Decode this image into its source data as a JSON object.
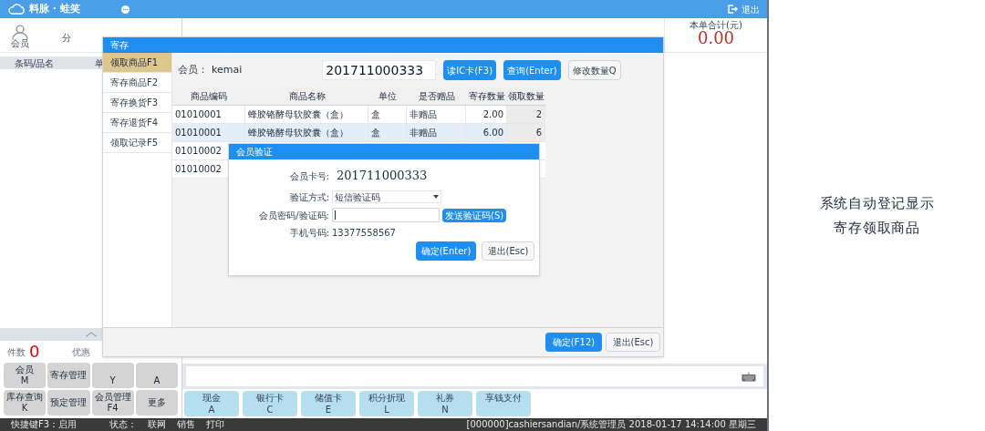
{
  "app": {
    "title": "料脉 · 蛙笑",
    "logout": "退出"
  },
  "header": {
    "member_label": "会员",
    "points_label": "分",
    "total_label": "本单合计(元)",
    "total": "0.00"
  },
  "left_panel": {
    "columns": [
      "条码/品名",
      "单"
    ],
    "count_label": "件数",
    "count": "0",
    "discount_label": "优惠"
  },
  "function_buttons": [
    {
      "label": "会员",
      "key": "M"
    },
    {
      "label": "寄存管理"
    },
    {
      "key": "Y"
    },
    {
      "key": "A"
    },
    {
      "label": "库存查询",
      "key": "K"
    },
    {
      "label": "预定管理"
    },
    {
      "label": "会员管理",
      "key": "F4"
    },
    {
      "label": "更多"
    }
  ],
  "payment_buttons": [
    {
      "label": "现金",
      "key": "A"
    },
    {
      "label": "银行卡",
      "key": "C"
    },
    {
      "label": "储值卡",
      "key": "E"
    },
    {
      "label": "积分折现",
      "key": "L"
    },
    {
      "label": "礼券",
      "key": "N"
    },
    {
      "label": "享钱支付"
    }
  ],
  "status_bar": {
    "items": [
      "快捷键F3：启用",
      "状态：",
      "联网",
      "销售",
      "打印"
    ],
    "right": "[000000]cashiersandian/系统管理员 2018-01-17 14:14:00 星期三"
  },
  "storage_dialog": {
    "title": "寄存",
    "nav": [
      {
        "label": "领取商品F1",
        "selected": true
      },
      {
        "label": "寄存商品F2",
        "selected": false
      },
      {
        "label": "寄存换货F3",
        "selected": false
      },
      {
        "label": "寄存退货F4",
        "selected": false
      },
      {
        "label": "领取记录F5",
        "selected": false
      }
    ],
    "member_label": "会员：",
    "member": "kemai",
    "card_input": "201711000333",
    "buttons": [
      "读IC卡(F3)",
      "查询(Enter)",
      "修改数量Q"
    ],
    "table": {
      "columns": [
        "商品编码",
        "商品名称",
        "单位",
        "是否赠品",
        "寄存数量",
        "领取数量"
      ],
      "rows": [
        {
          "selected": false,
          "cells": [
            "01010001",
            "蜂胶铬酵母软胶囊（盒）",
            "盒",
            "非赠品",
            "2.00",
            "2"
          ]
        },
        {
          "selected": true,
          "cells": [
            "01010001",
            "蜂胶铬酵母软胶囊（盒）",
            "盒",
            "非赠品",
            "6.00",
            "6"
          ]
        },
        {
          "selected": false,
          "cells": [
            "01010002"
          ]
        },
        {
          "selected": false,
          "cells": [
            "01010002"
          ]
        }
      ]
    },
    "confirm": "确定(F12)",
    "cancel": "退出(Esc)"
  },
  "verify_dialog": {
    "title": "会员验证",
    "card_label": "会员卡号:",
    "card": "201711000333",
    "method_label": "验证方式:",
    "method": "短信验证码",
    "code_label": "会员密码/验证码:",
    "send_button": "发送验证码(S)",
    "phone_label": "手机号码:",
    "phone": "13377558567",
    "confirm": "确定(Enter)",
    "cancel": "退出(Esc)"
  },
  "caption": [
    "系统自动登记显示",
    "寄存领取商品"
  ]
}
